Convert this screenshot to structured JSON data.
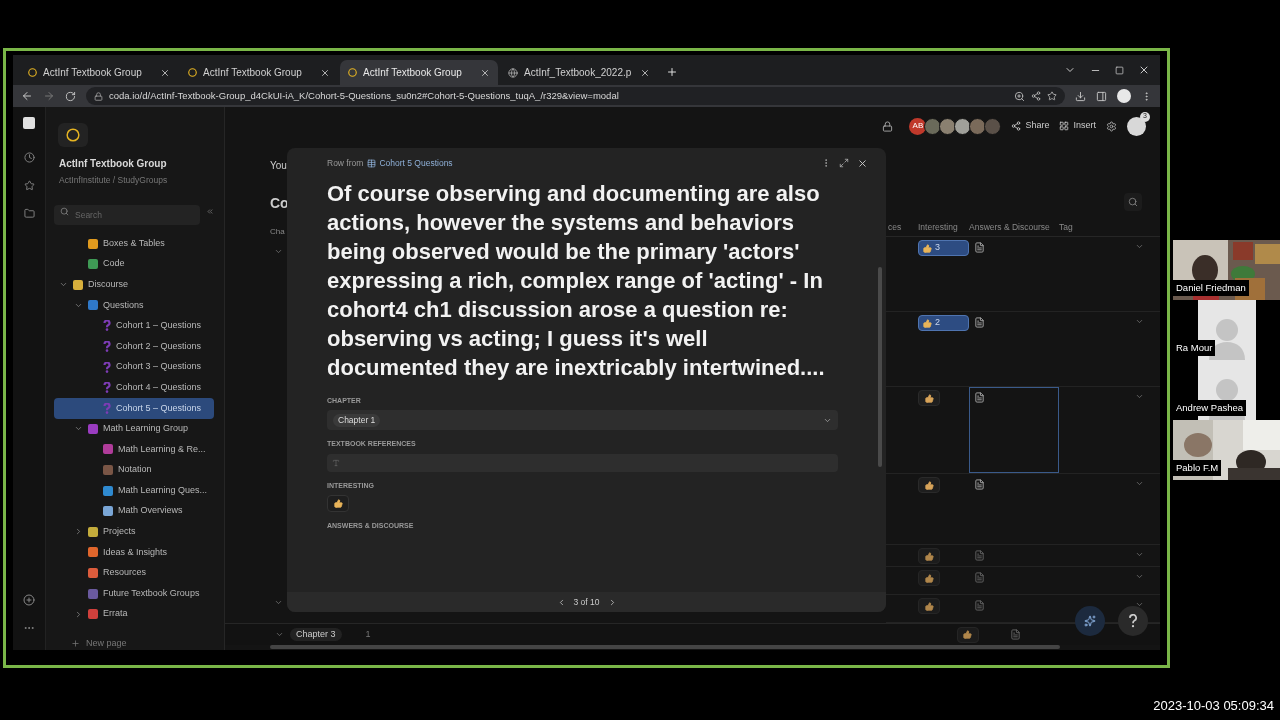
{
  "browser": {
    "tabs": [
      {
        "title": "ActInf Textbook Group",
        "kind": "doc",
        "selected": false
      },
      {
        "title": "ActInf Textbook Group",
        "kind": "doc",
        "selected": false
      },
      {
        "title": "ActInf Textbook Group",
        "kind": "doc",
        "selected": true
      },
      {
        "title": "ActInf_Textbook_2022.p",
        "kind": "web",
        "selected": false
      }
    ],
    "url": "coda.io/d/ActInf-Textbook-Group_d4CkUI-iA_K/Cohort-5-Questions_su0n2#Cohort-5-Questions_tuqA_/r329&view=modal"
  },
  "sidebar": {
    "doc_title": "ActInf Textbook Group",
    "doc_path": "ActInfInstitute / StudyGroups",
    "search": {
      "placeholder": "Search"
    },
    "tree": [
      {
        "children": [
          {
            "label": "Boxes & Tables",
            "kind": "page",
            "color": "#e09a1e",
            "selected": false
          },
          {
            "label": "Code",
            "kind": "page",
            "color": "#3f9a55",
            "selected": false
          }
        ]
      },
      {
        "label": "Discourse",
        "kind": "page",
        "color": "#d9b03c",
        "expanded": true,
        "selected": false,
        "children": [
          {
            "label": "Questions",
            "kind": "page",
            "color": "#2f78c8",
            "expanded": true,
            "selected": false,
            "children": [
              {
                "label": "Cohort 1 – Questions",
                "kind": "question",
                "color": "#7d3cb5",
                "selected": false
              },
              {
                "label": "Cohort 2 – Questions",
                "kind": "question",
                "color": "#7d3cb5",
                "selected": false
              },
              {
                "label": "Cohort 3 – Questions",
                "kind": "question",
                "color": "#7d3cb5",
                "selected": false
              },
              {
                "label": "Cohort 4 – Questions",
                "kind": "question",
                "color": "#7d3cb5",
                "selected": false
              },
              {
                "label": "Cohort 5 – Questions",
                "kind": "question",
                "color": "#7d3cb5",
                "selected": true
              }
            ]
          },
          {
            "label": "Math Learning Group",
            "kind": "page",
            "color": "#9a3cc0",
            "expanded": true,
            "selected": false,
            "children": [
              {
                "label": "Math Learning & Re...",
                "kind": "page",
                "color": "#b03c9a",
                "selected": false
              },
              {
                "label": "Notation",
                "kind": "page",
                "color": "#7a5646",
                "selected": false
              },
              {
                "label": "Math Learning Ques...",
                "kind": "page",
                "color": "#2f8ad0",
                "selected": false
              },
              {
                "label": "Math Overviews",
                "kind": "page",
                "color": "#7aa6d6",
                "selected": false
              }
            ]
          },
          {
            "label": "Projects",
            "kind": "page",
            "color": "#c4ac3c",
            "expanded": false,
            "selected": false
          },
          {
            "label": "Ideas & Insights",
            "kind": "page",
            "color": "#e0662c",
            "selected": false
          },
          {
            "label": "Resources",
            "kind": "page",
            "color": "#dc5c3c",
            "selected": false
          },
          {
            "label": "Future Textbook Groups",
            "kind": "page",
            "color": "#6a5a9e",
            "selected": false
          },
          {
            "label": "Errata",
            "kind": "page",
            "color": "#d0403c",
            "expanded": false,
            "selected": false
          }
        ]
      }
    ],
    "new_page": "New page"
  },
  "toolbar": {
    "avatar_initials": "AB",
    "share": "Share",
    "insert": "Insert",
    "notification_count": "3"
  },
  "page": {
    "intro": "You",
    "heading": "Co",
    "first_column": "Cha",
    "columns": [
      "ces",
      "Interesting",
      "Answers & Discourse",
      "Tag"
    ],
    "rows": [
      {
        "interesting": {
          "count": "3",
          "reacted": true
        },
        "selected": false
      },
      {
        "interesting": {
          "count": "2",
          "reacted": true
        },
        "selected": false
      },
      {
        "interesting": {
          "reacted": false
        },
        "selected": true
      },
      {
        "interesting": {
          "reacted": false
        },
        "selected": false
      },
      {
        "interesting": {
          "reacted": false
        },
        "selected": false
      },
      {
        "interesting": {
          "reacted": false
        },
        "selected": false
      },
      {
        "interesting": {
          "reacted": false
        },
        "selected": false
      }
    ],
    "group_row": {
      "label": "Chapter 3",
      "count": "1",
      "interesting": {
        "reacted": false
      }
    }
  },
  "modal": {
    "source_prefix": "Row from",
    "source_table": "Cohort 5 Questions",
    "title": "Of course observing and documenting are also actions, however the systems and behaviors being observed would be the primary 'actors' expressing a rich, complex range of 'acting' - In cohort4 ch1 discussion arose a question re: observing vs acting; I guess it's well documented they are inextricably intertwined....",
    "fields": [
      {
        "kind": "select",
        "label": "CHAPTER",
        "value": "Chapter 1"
      },
      {
        "kind": "text",
        "label": "TEXTBOOK REFERENCES"
      },
      {
        "kind": "reaction",
        "label": "INTERESTING",
        "reacted": false
      },
      {
        "kind": "heading",
        "label": "ANSWERS & DISCOURSE"
      }
    ],
    "pager": "3 of 10"
  },
  "participants": [
    {
      "name": "Daniel Friedman",
      "kind": "video"
    },
    {
      "name": "Ra Mour",
      "kind": "placeholder"
    },
    {
      "name": "Andrew Pashea",
      "kind": "placeholder"
    },
    {
      "name": "Pablo F.M",
      "kind": "video"
    }
  ],
  "timestamp": "2023-10-03 05:09:34"
}
